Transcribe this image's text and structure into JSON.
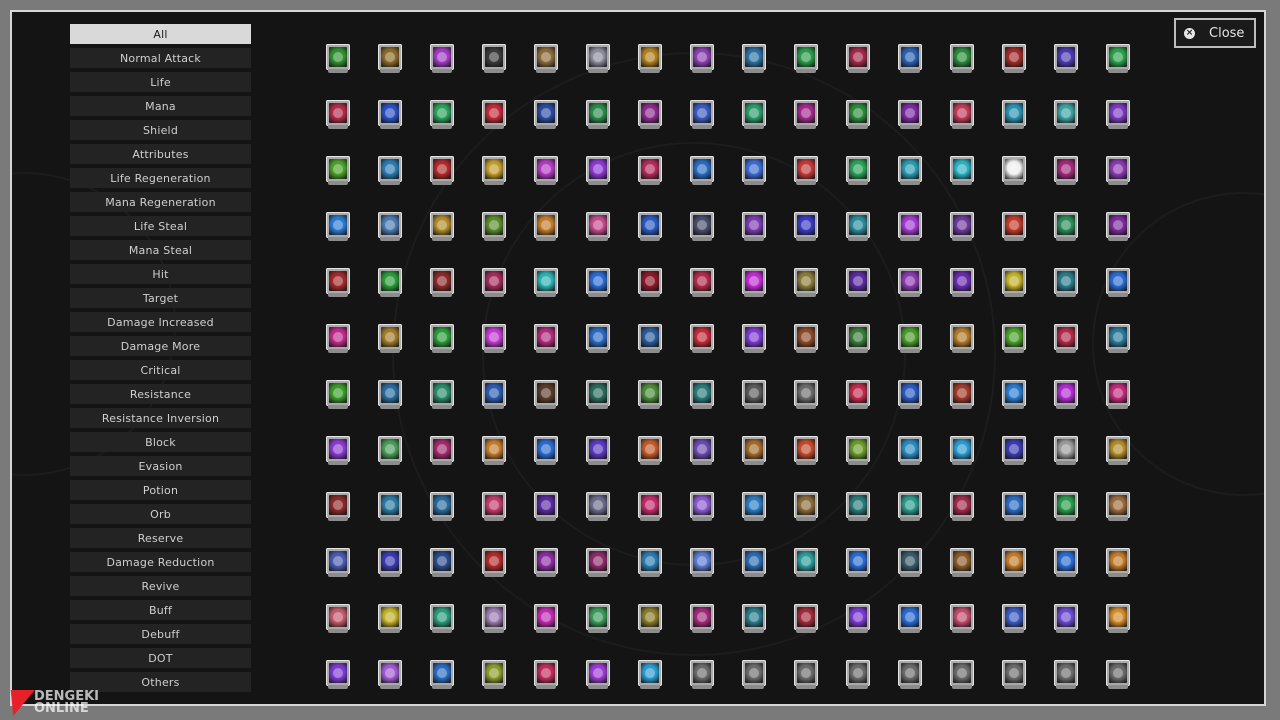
{
  "categories": [
    {
      "label": "All",
      "active": true
    },
    {
      "label": "Normal Attack"
    },
    {
      "label": "Life"
    },
    {
      "label": "Mana"
    },
    {
      "label": "Shield"
    },
    {
      "label": "Attributes"
    },
    {
      "label": "Life Regeneration"
    },
    {
      "label": "Mana Regeneration"
    },
    {
      "label": "Life Steal"
    },
    {
      "label": "Mana Steal"
    },
    {
      "label": "Hit"
    },
    {
      "label": "Target"
    },
    {
      "label": "Damage Increased"
    },
    {
      "label": "Damage More"
    },
    {
      "label": "Critical"
    },
    {
      "label": "Resistance"
    },
    {
      "label": "Resistance Inversion"
    },
    {
      "label": "Block"
    },
    {
      "label": "Evasion"
    },
    {
      "label": "Potion"
    },
    {
      "label": "Orb"
    },
    {
      "label": "Reserve"
    },
    {
      "label": "Damage Reduction"
    },
    {
      "label": "Revive"
    },
    {
      "label": "Buff"
    },
    {
      "label": "Debuff"
    },
    {
      "label": "DOT"
    },
    {
      "label": "Others"
    }
  ],
  "close_button": {
    "label": "Close",
    "icon": "close-circle-icon"
  },
  "watermark": {
    "line1": "DENGEKI",
    "line2": "ONLINE"
  },
  "skill_icons": [
    "#2f8f2f",
    "#8a6a2a",
    "#a03ac0",
    "#3a3a3a",
    "#8a6a3a",
    "#8a8a9a",
    "#b08020",
    "#8a40b0",
    "#2a70a0",
    "#2a9a4a",
    "#a02a4a",
    "#2a60b0",
    "#2a8a3a",
    "#a02a2a",
    "#4a3ab0",
    "#2aa04a",
    "#b02a4a",
    "#2a50c0",
    "#2aa05a",
    "#c02a3a",
    "#2a4aa0",
    "#2a8a4a",
    "#8a2a8a",
    "#3a5ac0",
    "#2a9a6a",
    "#a02a8a",
    "#2a8a3a",
    "#7a2aa0",
    "#c03a5a",
    "#2a90b0",
    "#3aa0a0",
    "#7a3ac0",
    "#4aa02a",
    "#2a7ab0",
    "#b02a2a",
    "#c09a2a",
    "#b03ac0",
    "#8a3ad0",
    "#b02a5a",
    "#2a6ac0",
    "#3a6ad0",
    "#c03a3a",
    "#2aa05a",
    "#2a9ab0",
    "#2ab0c0",
    "#f0f0f0",
    "#a02a7a",
    "#8a3ab0",
    "#2a7ad0",
    "#4a7ab0",
    "#b08a2a",
    "#5a8a2a",
    "#c07a2a",
    "#c04a8a",
    "#2a5ac0",
    "#4a4a6a",
    "#7a3ab0",
    "#3a3ac0",
    "#2a8a9a",
    "#a03ad0",
    "#6a3a9a",
    "#c03a2a",
    "#2a8a5a",
    "#7a2a9a",
    "#a02a2a",
    "#2a9a3a",
    "#8a2a2a",
    "#a02a5a",
    "#2ab0b0",
    "#2a6ad0",
    "#8a1a2a",
    "#b02a4a",
    "#c02ad0",
    "#8a7a3a",
    "#5a2aa0",
    "#8a3ab0",
    "#6a2ab0",
    "#c0b02a",
    "#2a7a8a",
    "#2a6ad0",
    "#c02a8a",
    "#a07a2a",
    "#2a9a3a",
    "#c03ad0",
    "#b02a7a",
    "#2a6ac0",
    "#2a5a9a",
    "#c02a3a",
    "#7a3ad0",
    "#8a4a2a",
    "#3a7a3a",
    "#4a9a2a",
    "#b07a2a",
    "#4aa02a",
    "#b02a4a",
    "#2a7a9a",
    "#3a9a2a",
    "#2a6a9a",
    "#2a8a6a",
    "#2a5ab0",
    "#5a3a2a",
    "#2a6a5a",
    "#4a8a3a",
    "#2a7a7a",
    "#5a5a5a",
    "#6a6a6a",
    "#c02a4a",
    "#2a5ac0",
    "#a03a2a",
    "#2a7ad0",
    "#b02ad0",
    "#c02a7a",
    "#8a3ad0",
    "#4a9a5a",
    "#a02a6a",
    "#c07a2a",
    "#2a6ad0",
    "#5a3ac0",
    "#c05a2a",
    "#6a4ab0",
    "#a06a2a",
    "#c04a2a",
    "#6a9a2a",
    "#2a8ac0",
    "#2a9ad0",
    "#3a3ab0",
    "#9a9a9a",
    "#b08a2a",
    "#8a2a2a",
    "#2a7aa0",
    "#2a6a9a",
    "#c03a6a",
    "#5a2aa0",
    "#6a6a8a",
    "#c02a6a",
    "#8a5ad0",
    "#2a7ac0",
    "#8a6a3a",
    "#2a7a7a",
    "#2a9a8a",
    "#a02a4a",
    "#2a6ac0",
    "#2a9a4a",
    "#9a6a3a",
    "#4a5ab0",
    "#3a3ab0",
    "#2a4a8a",
    "#b02a2a",
    "#8a2aa0",
    "#8a2a6a",
    "#2a7ab0",
    "#5a7ad0",
    "#2a6ab0",
    "#2a9a9a",
    "#2a6ad0",
    "#3a5a6a",
    "#8a5a2a",
    "#c07a2a",
    "#2a6ad0",
    "#c07a2a",
    "#c05a6a",
    "#c0b02a",
    "#2a9a7a",
    "#9a7ab0",
    "#c02ab0",
    "#3a9a5a",
    "#8a7a2a",
    "#a02a7a",
    "#2a7a8a",
    "#a02a3a",
    "#7a3ad0",
    "#2a6ad0",
    "#c04a6a",
    "#3a5ac0",
    "#6a4ad0",
    "#d08a2a",
    "#7a3ad0",
    "#a05ad0",
    "#2a6ac0",
    "#8a9a2a",
    "#c02a5a",
    "#9a3ad0",
    "#2a9ad0",
    "#6a6a6a",
    "#6a6a6a",
    "#6a6a6a",
    "#6a6a6a",
    "#6a6a6a",
    "#6a6a6a",
    "#6a6a6a",
    "#6a6a6a",
    "#6a6a6a",
    "#6a6a6a",
    "#c02a4a",
    "#2a7ad0",
    "#4ac05a",
    "#8a4ad0",
    "#e08a1a",
    "#7a7a7a"
  ],
  "book_start_index": 193
}
